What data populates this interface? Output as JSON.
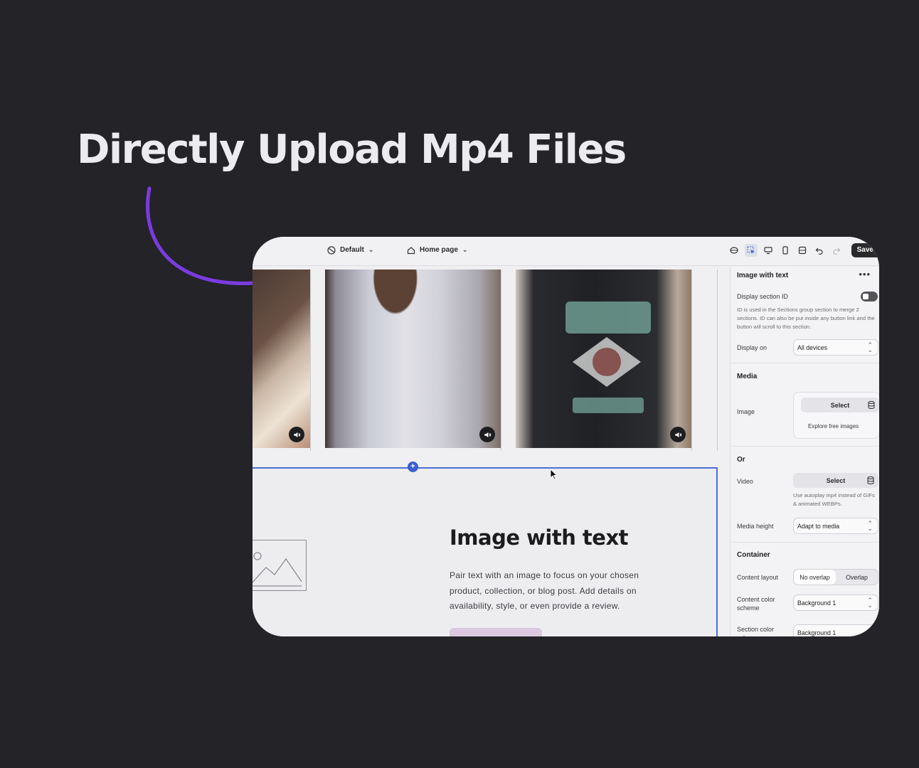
{
  "headline": "Directly Upload Mp4 Files",
  "colors": {
    "background": "#242328",
    "accent_arrow": "#7a3ce0",
    "selection": "#4a6fd1",
    "button_tint": "#d9c8de"
  },
  "topbar": {
    "theme_label": "Default",
    "page_label": "Home page",
    "save_label": "Save",
    "tools": [
      "apps-icon",
      "inspector-icon",
      "desktop-icon",
      "mobile-icon",
      "fullwidth-icon",
      "undo-icon",
      "redo-icon"
    ]
  },
  "canvas": {
    "videos": [
      {
        "name": "video-left-partial",
        "icon": "mute-icon"
      },
      {
        "name": "video-white-shirt",
        "icon": "mute-icon"
      },
      {
        "name": "video-ducks-shirt",
        "icon": "mute-icon"
      }
    ],
    "section": {
      "heading": "Image with text",
      "body": "Pair text with an image to focus on your chosen product, collection, or blog post. Add details on availability, style, or even provide a review."
    }
  },
  "panel": {
    "title": "Image with text",
    "display_section_id": "Display section ID",
    "display_section_id_help": "ID is used in the Sections group section to merge 2 sections. ID can also be put inside any button link and the button will scroll to this section.",
    "display_on_label": "Display on",
    "display_on_value": "All devices",
    "media_heading": "Media",
    "image_label": "Image",
    "select_label": "Select",
    "explore_label": "Explore free images",
    "or_heading": "Or",
    "video_label": "Video",
    "video_help": "Use autoplay mp4 instead of GIFs & animated WEBPs.",
    "media_height_label": "Media height",
    "media_height_value": "Adapt to media",
    "container_heading": "Container",
    "content_layout_label": "Content layout",
    "content_layout_options": [
      "No overlap",
      "Overlap"
    ],
    "content_color_label": "Content color scheme",
    "content_color_value": "Background 1",
    "section_color_label": "Section color scheme",
    "section_color_value": "Background 1"
  }
}
